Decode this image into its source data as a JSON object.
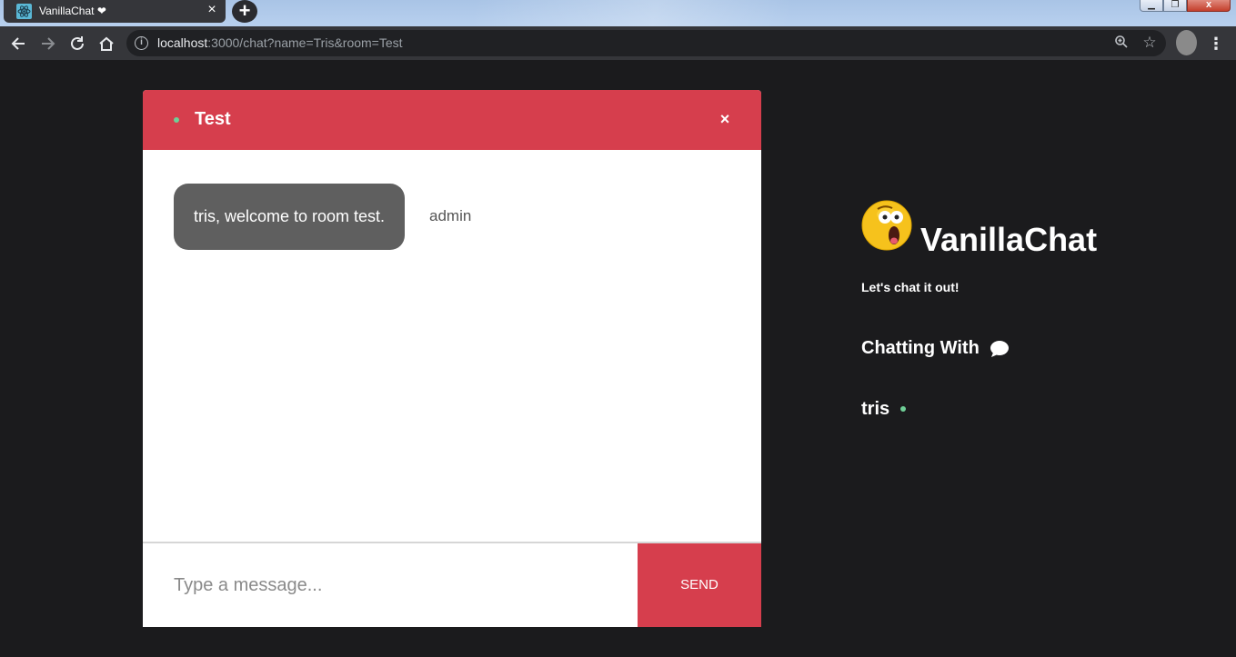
{
  "browser": {
    "tab_title": "VanillaChat ❤",
    "tab_close": "×",
    "new_tab": "+",
    "url_host": "localhost",
    "url_rest": ":3000/chat?name=Tris&room=Test",
    "window_controls": {
      "close": "x"
    }
  },
  "chat": {
    "room_name": "Test",
    "close_label": "×",
    "messages": [
      {
        "text": "tris, welcome to room test.",
        "sender": "admin"
      }
    ],
    "input_placeholder": "Type a message...",
    "send_label": "SEND"
  },
  "sidebar": {
    "app_name": "VanillaChat",
    "tagline": "Let's chat it out!",
    "chatting_with_label": "Chatting With",
    "users": [
      {
        "name": "tris",
        "status": "online"
      }
    ]
  },
  "colors": {
    "accent": "#d63e4d",
    "background": "#1b1b1d",
    "online": "#6fcf97",
    "bubble": "#5f5f5f"
  },
  "icons": {
    "logo": "astonished-face-emoji",
    "chatting_with": "speech-bubble-icon"
  }
}
